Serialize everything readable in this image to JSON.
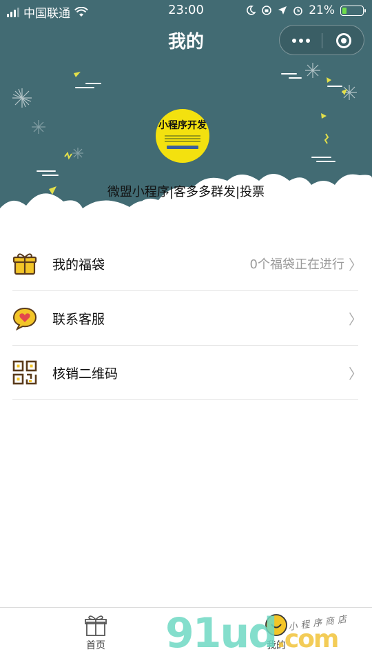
{
  "status_bar": {
    "carrier": "中国联通",
    "time": "23:00",
    "battery": "21%",
    "battery_level": 0.21,
    "icons": [
      "signal-icon",
      "wifi-icon",
      "moon-icon",
      "rotation-lock-icon",
      "location-icon",
      "alarm-icon",
      "battery-icon"
    ]
  },
  "header": {
    "title": "我的",
    "menu_icon": "more-dots-icon",
    "close_icon": "miniprogram-close-icon",
    "background": "#426b73"
  },
  "profile": {
    "logo_text": "小程序开发",
    "name": "微盟小程序|客多多群发|投票"
  },
  "menu": [
    {
      "icon": "gift-bag-icon",
      "label": "我的福袋",
      "value": "0个福袋正在进行"
    },
    {
      "icon": "heart-chat-icon",
      "label": "联系客服",
      "value": ""
    },
    {
      "icon": "qr-code-icon",
      "label": "核销二维码",
      "value": ""
    }
  ],
  "chevron": "〉",
  "tabbar": {
    "home_label": "首页",
    "mine_label": "我的",
    "active_color": "#f3c528"
  },
  "watermark": {
    "text": "91ud",
    "domain": ".com",
    "subtitle": "小程序商店"
  }
}
